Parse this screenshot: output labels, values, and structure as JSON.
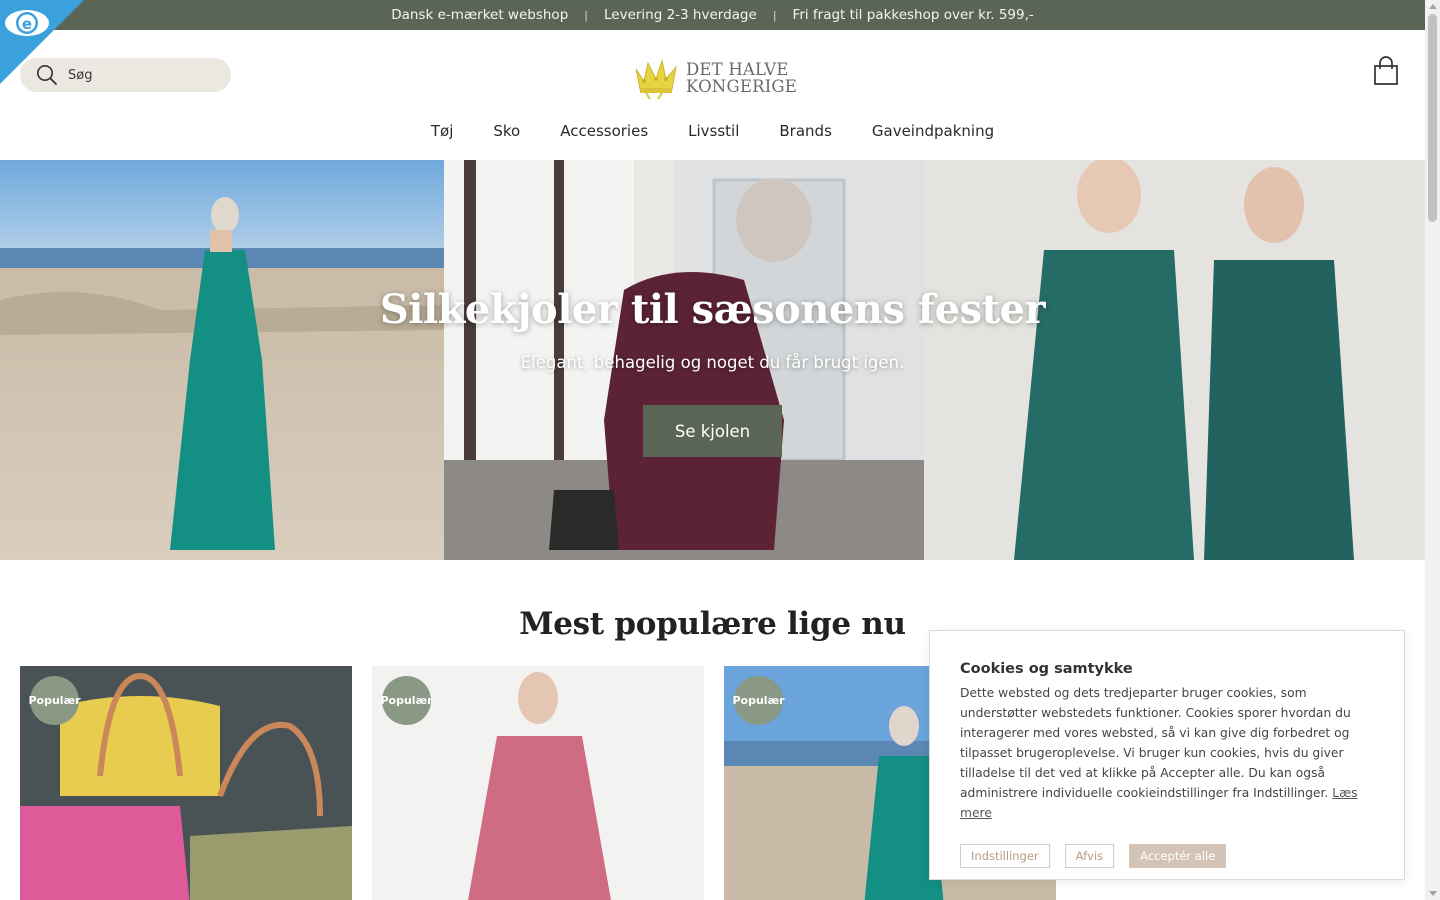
{
  "topbar": {
    "items": [
      "Dansk e-mærket webshop",
      "Levering 2-3 hverdage",
      "Fri fragt til pakkeshop over kr. 599,-"
    ],
    "separator": "|",
    "bg_color": "#5b6556"
  },
  "emark": {
    "letter": "e",
    "color": "#3ba1dc"
  },
  "header": {
    "search": {
      "placeholder": "Søg"
    },
    "logo": {
      "line1": "DET HALVE",
      "line2": "KONGERIGE"
    },
    "nav": [
      "Tøj",
      "Sko",
      "Accessories",
      "Livsstil",
      "Brands",
      "Gaveindpakning"
    ]
  },
  "hero": {
    "title": "Silkekjoler til sæsonens fester",
    "subtitle": "Elegant, behagelig og noget du får brugt igen.",
    "button": "Se kjolen"
  },
  "popular": {
    "title": "Mest populære lige nu",
    "badge": "Populær",
    "cards": [
      {
        "image": "straw-baskets"
      },
      {
        "image": "pink-linen-dress"
      },
      {
        "image": "teal-dress-beach"
      }
    ]
  },
  "cookie": {
    "title": "Cookies og samtykke",
    "text": "Dette websted og dets tredjeparter bruger cookies, som understøtter webstedets funktioner. Cookies sporer hvordan du interagerer med vores websted, så vi kan give dig forbedret og tilpasset brugeroplevelse. Vi bruger kun cookies, hvis du giver tilladelse til det ved at klikke på Accepter alle. Du kan også administrere individuelle cookieindstillinger fra Indstillinger.",
    "link": "Læs mere",
    "buttons": {
      "settings": "Indstillinger",
      "reject": "Afvis",
      "accept": "Acceptér alle"
    }
  }
}
